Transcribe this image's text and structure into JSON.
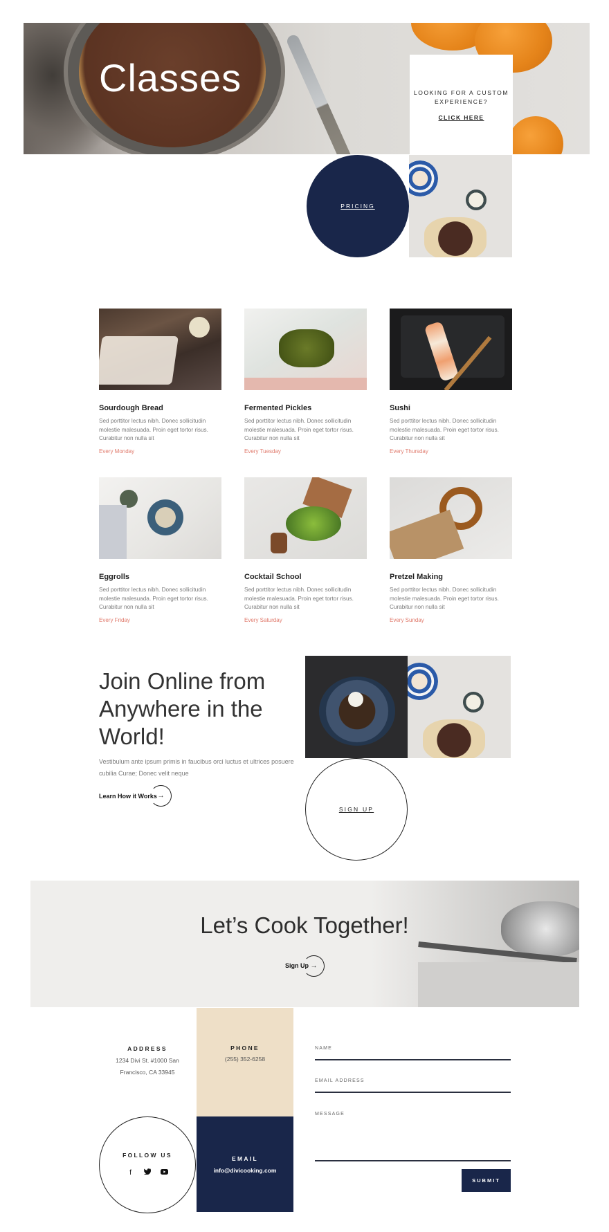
{
  "hero": {
    "title": "Classes",
    "custom_text": "LOOKING FOR A CUSTOM EXPERIENCE?",
    "custom_link": "CLICK HERE",
    "pricing_label": "PRICING"
  },
  "classes": [
    {
      "title": "Sourdough Bread",
      "desc": "Sed porttitor lectus nibh. Donec sollicitudin molestie malesuada. Proin eget tortor risus. Curabitur non nulla sit",
      "day": "Every Monday"
    },
    {
      "title": "Fermented Pickles",
      "desc": "Sed porttitor lectus nibh. Donec sollicitudin molestie malesuada. Proin eget tortor risus. Curabitur non nulla sit",
      "day": "Every Tuesday"
    },
    {
      "title": "Sushi",
      "desc": "Sed porttitor lectus nibh. Donec sollicitudin molestie malesuada. Proin eget tortor risus. Curabitur non nulla sit",
      "day": "Every Thursday"
    },
    {
      "title": "Eggrolls",
      "desc": "Sed porttitor lectus nibh. Donec sollicitudin molestie malesuada. Proin eget tortor risus. Curabitur non nulla sit",
      "day": "Every Friday"
    },
    {
      "title": "Cocktail School",
      "desc": "Sed porttitor lectus nibh. Donec sollicitudin molestie malesuada. Proin eget tortor risus. Curabitur non nulla sit",
      "day": "Every Saturday"
    },
    {
      "title": "Pretzel Making",
      "desc": "Sed porttitor lectus nibh. Donec sollicitudin molestie malesuada. Proin eget tortor risus. Curabitur non nulla sit",
      "day": "Every Sunday"
    }
  ],
  "join": {
    "title": "Join Online from Anywhere in the World!",
    "desc": "Vestibulum ante ipsum primis in faucibus orci luctus et ultrices posuere cubilia Curae; Donec velit neque",
    "link": "Learn How it Works",
    "arrow": "→",
    "signup_label": "SIGN UP"
  },
  "cook": {
    "title": "Let’s Cook Together!",
    "link": "Sign Up",
    "arrow": "→"
  },
  "contact": {
    "address_label": "ADDRESS",
    "address_line1": "1234 Divi St. #1000 San",
    "address_line2": "Francisco, CA 33945",
    "phone_label": "PHONE",
    "phone_value": "(255) 352-6258",
    "follow_label": "FOLLOW US",
    "email_label": "EMAIL",
    "email_value": "info@divicooking.com",
    "social_icons": [
      "facebook-icon",
      "twitter-icon",
      "youtube-icon"
    ],
    "form": {
      "name_label": "NAME",
      "email_label": "EMAIL ADDRESS",
      "message_label": "MESSAGE",
      "submit_label": "SUBMIT"
    }
  },
  "colors": {
    "navy": "#19264a",
    "beige": "#eedfc7",
    "accent": "#e07a6c"
  }
}
